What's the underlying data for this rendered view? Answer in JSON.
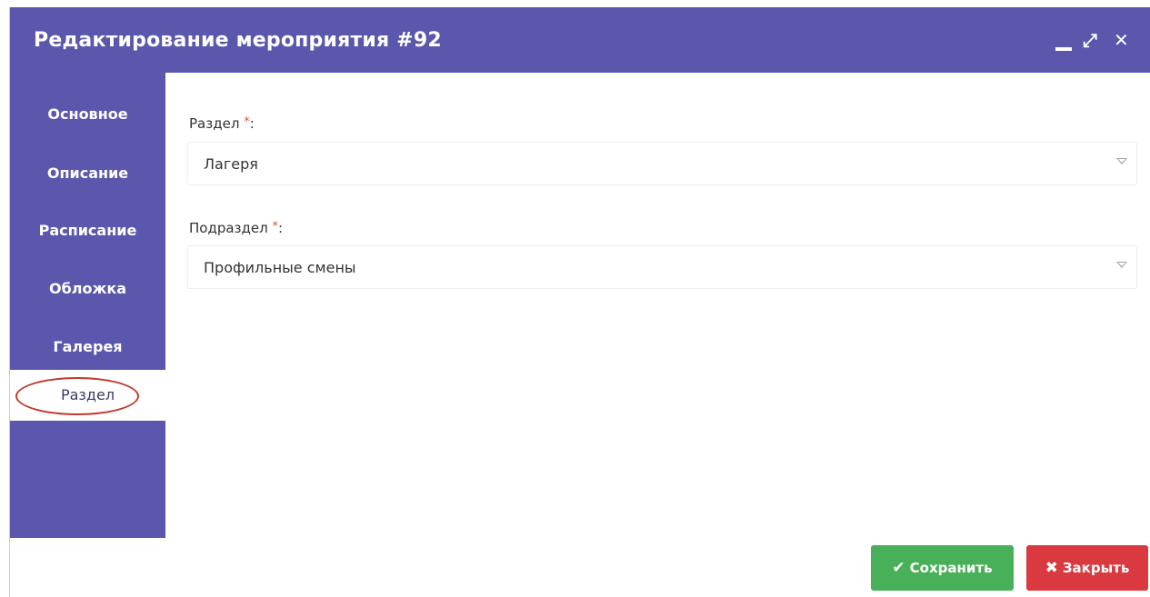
{
  "dialog": {
    "title": "Редактирование мероприятия #92",
    "controls": {
      "minimize_label": "_",
      "maximize_label": "⤢",
      "close_label": "✕"
    }
  },
  "sidebar": {
    "items": [
      {
        "label": "Основное"
      },
      {
        "label": "Описание"
      },
      {
        "label": "Расписание"
      },
      {
        "label": "Обложка"
      },
      {
        "label": "Галерея"
      },
      {
        "label": "Раздел",
        "active": true
      }
    ]
  },
  "form": {
    "section": {
      "label": "Раздел",
      "required_mark": "*",
      "colon": ":",
      "value": "Лагеря"
    },
    "subsection": {
      "label": "Подраздел",
      "required_mark": "*",
      "colon": ":",
      "value": "Профильные смены"
    }
  },
  "footer": {
    "save_label": "Сохранить",
    "save_icon": "✔",
    "close_label": "Закрыть",
    "close_icon": "✖"
  },
  "colors": {
    "header": "#5a57ad",
    "save": "#48b058",
    "close": "#d9393f",
    "required": "#e74c3c",
    "highlight": "#c0392b"
  },
  "icons": {
    "minimize": "minimize-icon",
    "maximize": "maximize-icon",
    "close": "close-icon",
    "dropdown": "chevron-down-icon",
    "check": "check-icon",
    "cross": "x-icon"
  }
}
